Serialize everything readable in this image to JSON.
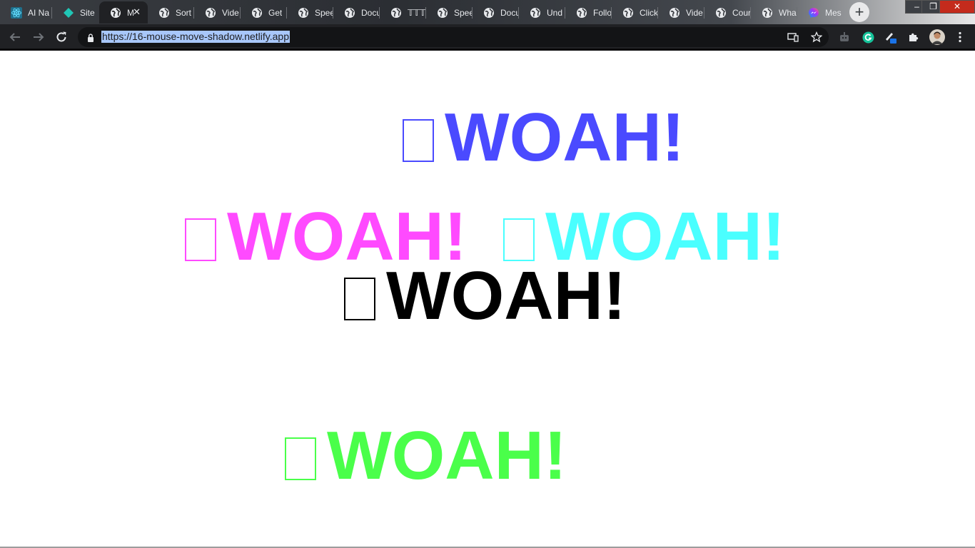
{
  "browser": {
    "tabs": [
      {
        "label": "AI Na",
        "icon": "react-icon",
        "active": false
      },
      {
        "label": "Site ",
        "icon": "netlify-icon",
        "active": false
      },
      {
        "label": "M",
        "icon": "globe-icon",
        "active": true
      },
      {
        "label": "Sort",
        "icon": "globe-icon",
        "active": false
      },
      {
        "label": "Vide",
        "icon": "globe-icon",
        "active": false
      },
      {
        "label": "Get ",
        "icon": "globe-icon",
        "active": false
      },
      {
        "label": "Spee",
        "icon": "globe-icon",
        "active": false
      },
      {
        "label": "Docu",
        "icon": "globe-icon",
        "active": false
      },
      {
        "label": "𝕋𝕋𝕋",
        "icon": "globe-icon",
        "active": false
      },
      {
        "label": "Spee",
        "icon": "globe-icon",
        "active": false
      },
      {
        "label": "Docu",
        "icon": "globe-icon",
        "active": false
      },
      {
        "label": "Und",
        "icon": "globe-icon",
        "active": false
      },
      {
        "label": "Follo",
        "icon": "globe-icon",
        "active": false
      },
      {
        "label": "Click",
        "icon": "globe-icon",
        "active": false
      },
      {
        "label": "Vide",
        "icon": "globe-icon",
        "active": false
      },
      {
        "label": "Cour",
        "icon": "globe-icon",
        "active": false
      },
      {
        "label": "Wha",
        "icon": "globe-icon",
        "active": false
      },
      {
        "label": "Mes",
        "icon": "messenger-icon",
        "active": false
      }
    ],
    "new_tab_label": "+",
    "window_controls": {
      "minimize": "–",
      "restore": "❐",
      "close": "✕"
    },
    "url": "https://16-mouse-move-shadow.netlify.app"
  },
  "page": {
    "texts": [
      {
        "text": "WOAH!",
        "color": "#4a4aff"
      },
      {
        "text": "WOAH!",
        "color": "#ff4aff"
      },
      {
        "text": "WOAH!",
        "color": "#4affff"
      },
      {
        "text": "WOAH!",
        "color": "#000000"
      },
      {
        "text": "WOAH!",
        "color": "#4aff4a"
      }
    ]
  }
}
